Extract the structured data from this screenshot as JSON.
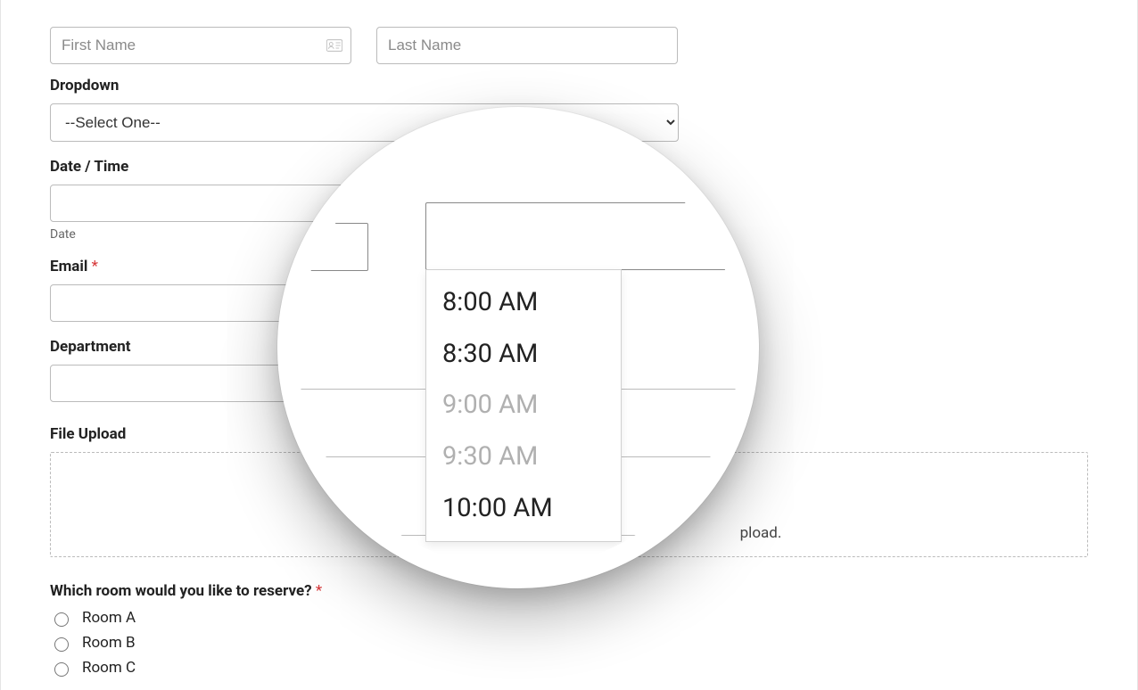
{
  "name": {
    "first_placeholder": "First Name",
    "last_placeholder": "Last Name"
  },
  "dropdown": {
    "label": "Dropdown",
    "placeholder": "--Select One--"
  },
  "datetime": {
    "label": "Date / Time",
    "date_sub": "Date"
  },
  "email": {
    "label": "Email"
  },
  "department": {
    "label": "Department"
  },
  "file": {
    "label": "File Upload",
    "hint_suffix": "pload."
  },
  "room": {
    "label": "Which room would you like to reserve?",
    "options": [
      "Room A",
      "Room B",
      "Room C"
    ]
  },
  "required_mark": "*",
  "time_options": [
    {
      "label": "8:00 AM",
      "disabled": false
    },
    {
      "label": "8:30 AM",
      "disabled": false
    },
    {
      "label": "9:00 AM",
      "disabled": true
    },
    {
      "label": "9:30 AM",
      "disabled": true
    },
    {
      "label": "10:00 AM",
      "disabled": false
    }
  ]
}
